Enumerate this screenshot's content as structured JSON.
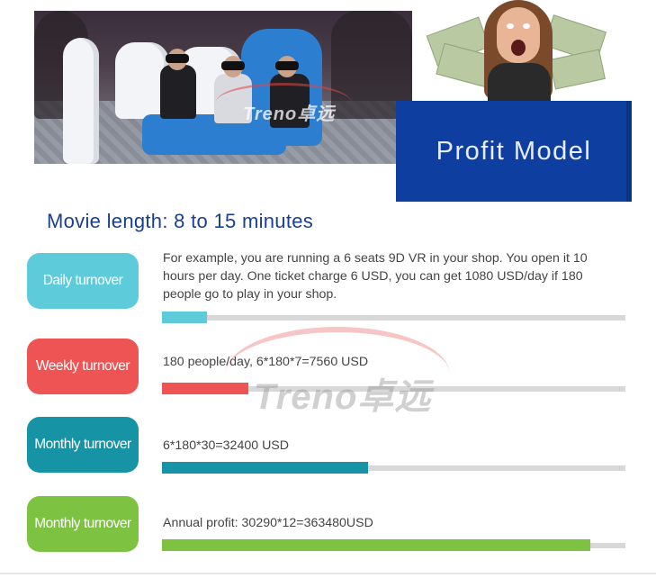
{
  "header": {
    "profit_title": "Profit Model",
    "watermark_small": "Treno卓远"
  },
  "headline": "Movie length: 8 to 15 minutes",
  "watermark": "Treno卓远",
  "rows": [
    {
      "label": "Daily turnover",
      "text": "For example, you are running a 6 seats 9D VR in your shop. You open it 10 hours per day. One ticket charge 6 USD, you can get 1080 USD/day if 180 people go to play in your shop.",
      "color": "#5dcbd9",
      "progress": 0.097
    },
    {
      "label": "Weekly turnover",
      "text": "180 people/day, 6*180*7=7560 USD",
      "color": "#ee5454",
      "progress": 0.186
    },
    {
      "label": "Monthly turnover",
      "text": "6*180*30=32400 USD",
      "color": "#1694a6",
      "progress": 0.445
    },
    {
      "label": "Monthly turnover",
      "text": "Annual profit: 30290*12=363480USD",
      "color": "#7dc341",
      "progress": 0.924
    }
  ],
  "colors": {
    "profit_box": "#0e3fa0",
    "headline": "#1a3f8f",
    "track": "#d8d8d8"
  }
}
